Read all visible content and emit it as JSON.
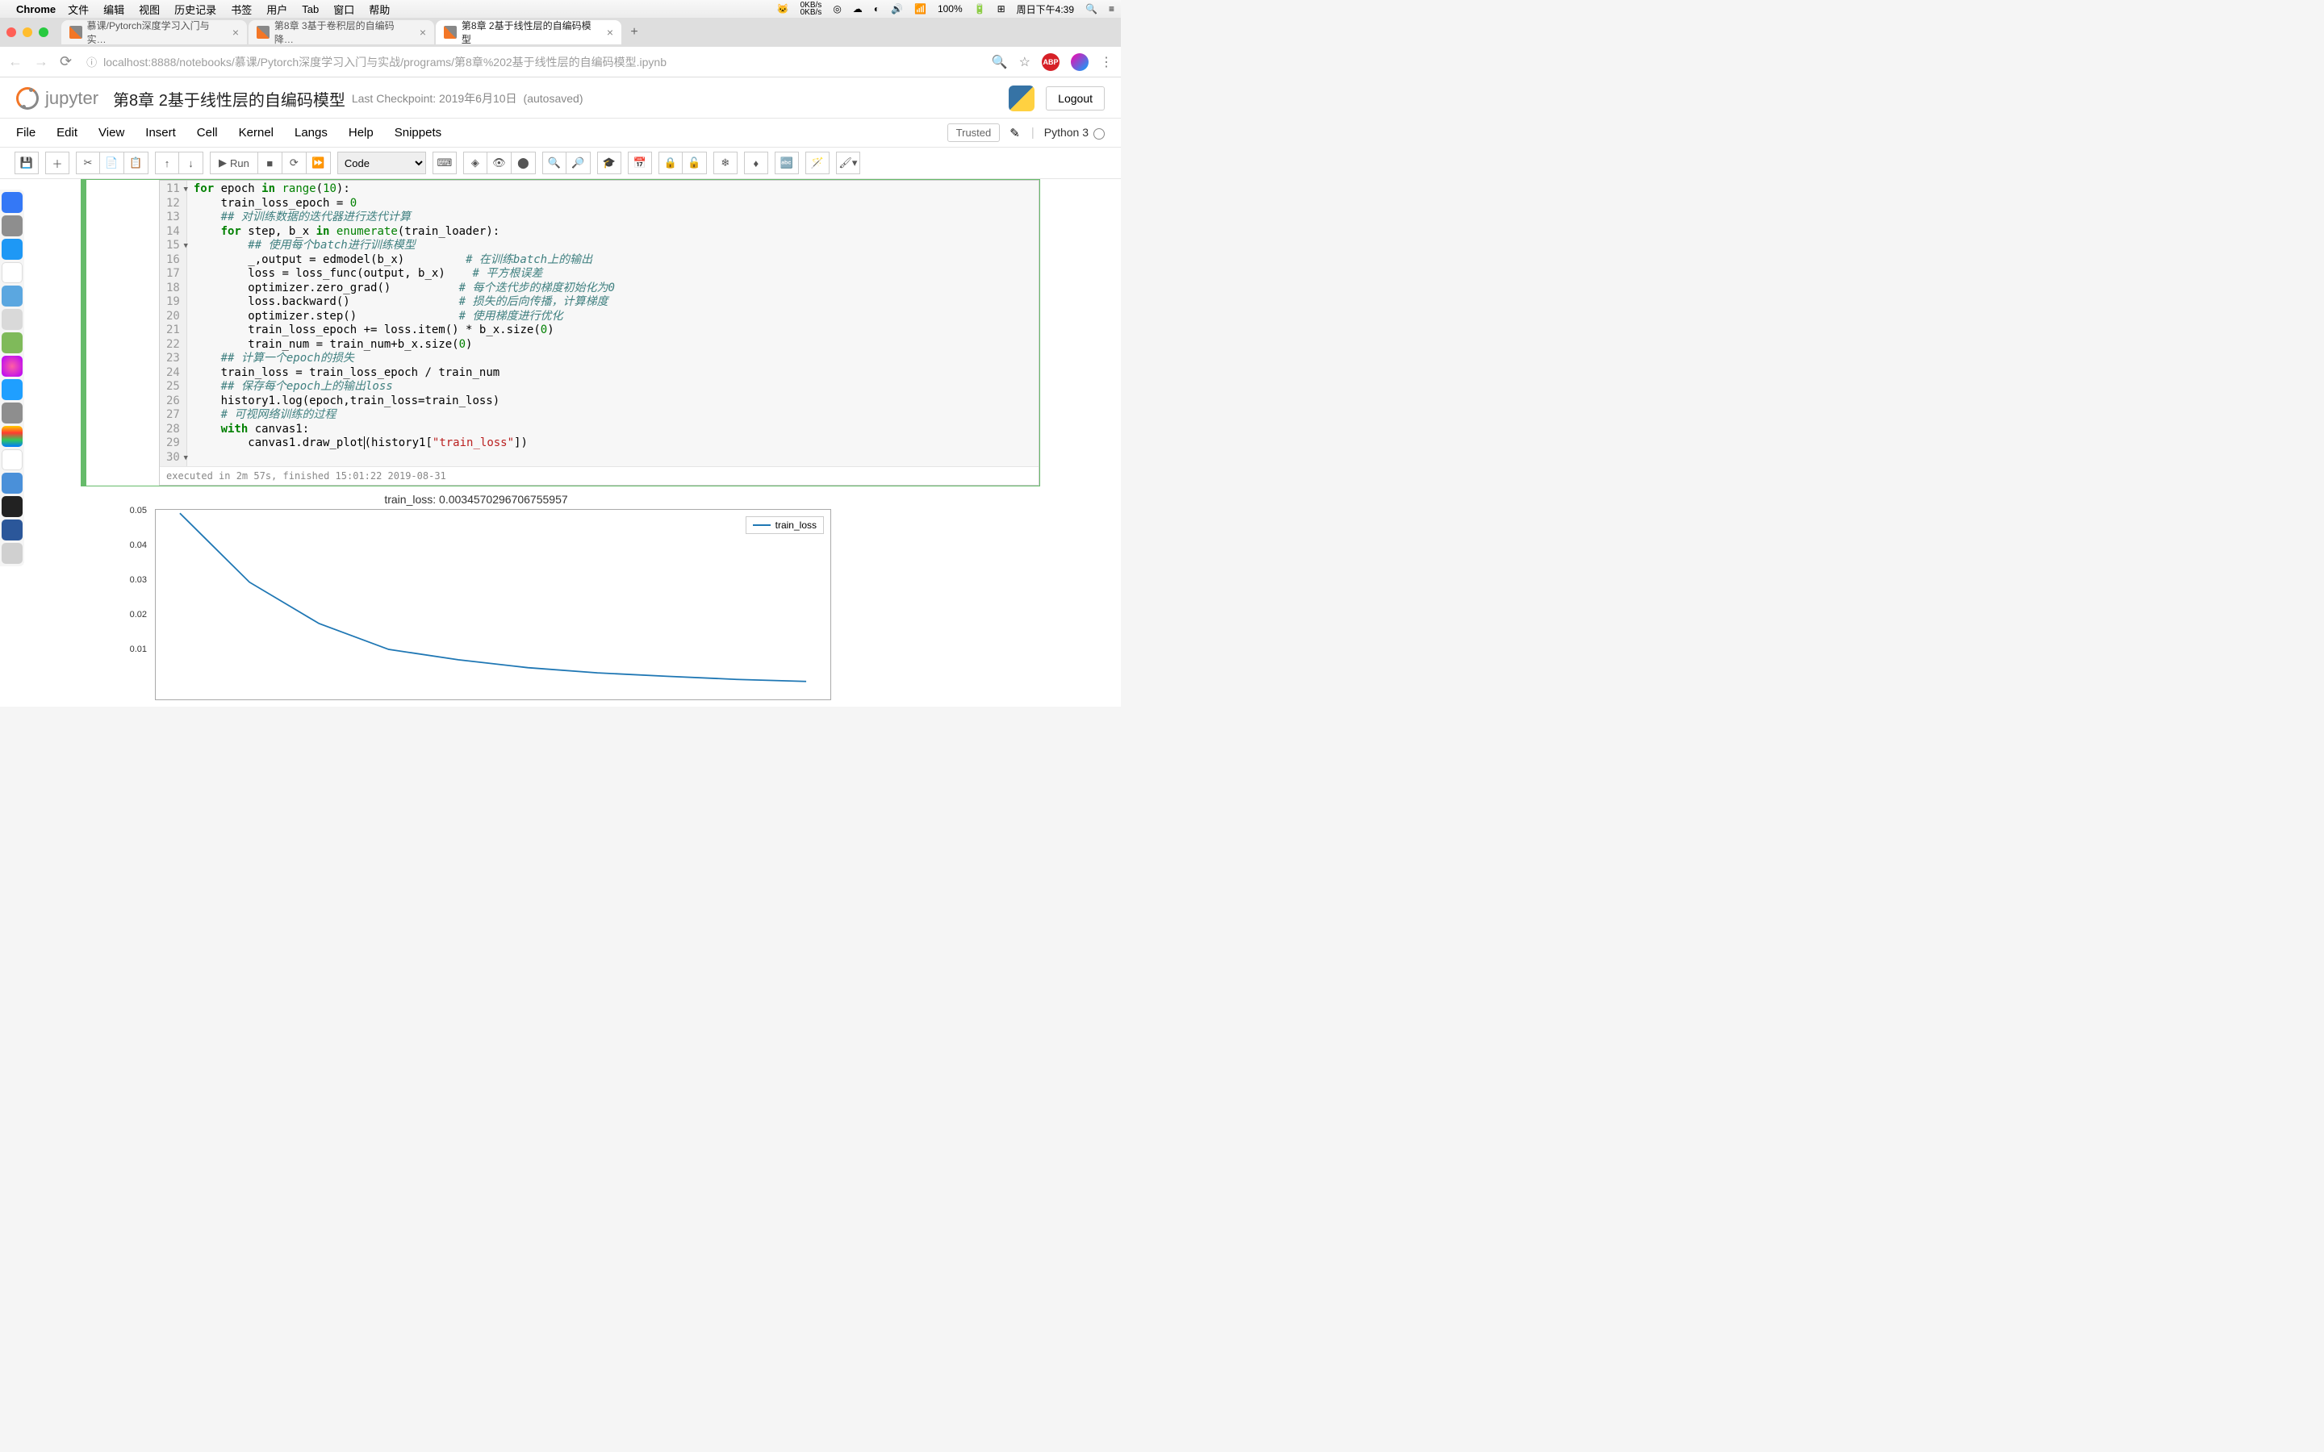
{
  "menubar": {
    "app": "Chrome",
    "items": [
      "文件",
      "编辑",
      "视图",
      "历史记录",
      "书签",
      "用户",
      "Tab",
      "窗口",
      "帮助"
    ],
    "kb_up": "0KB/s",
    "kb_dn": "0KB/s",
    "battery": "100%",
    "clock": "周日下午4:39"
  },
  "tabs": [
    {
      "title": "慕课/Pytorch深度学习入门与实…",
      "active": false
    },
    {
      "title": "第8章 3基于卷积层的自编码降…",
      "active": false
    },
    {
      "title": "第8章 2基于线性层的自编码模型",
      "active": true
    }
  ],
  "url": "localhost:8888/notebooks/慕课/Pytorch深度学习入门与实战/programs/第8章%202基于线性层的自编码模型.ipynb",
  "jupyter": {
    "logo": "jupyter",
    "title": "第8章 2基于线性层的自编码模型",
    "checkpoint": "Last Checkpoint: 2019年6月10日",
    "autosaved": "(autosaved)",
    "logout": "Logout",
    "menus": [
      "File",
      "Edit",
      "View",
      "Insert",
      "Cell",
      "Kernel",
      "Langs",
      "Help",
      "Snippets"
    ],
    "trusted": "Trusted",
    "kernel": "Python 3",
    "run": "Run",
    "celltype": "Code"
  },
  "code": {
    "start_line": 11,
    "lines": [
      {
        "n": 11,
        "fold": true,
        "tokens": [
          [
            "kw",
            "for"
          ],
          [
            "nm",
            " epoch "
          ],
          [
            "kw",
            "in"
          ],
          [
            "nm",
            " "
          ],
          [
            "bi",
            "range"
          ],
          [
            "op",
            "("
          ],
          [
            "num",
            "10"
          ],
          [
            "op",
            "):"
          ]
        ]
      },
      {
        "n": 12,
        "tokens": [
          [
            "nm",
            "    train_loss_epoch "
          ],
          [
            "op",
            "= "
          ],
          [
            "num",
            "0"
          ]
        ]
      },
      {
        "n": 13,
        "tokens": [
          [
            "nm",
            "    "
          ],
          [
            "cm",
            "## 对训练数据的迭代器进行迭代计算"
          ]
        ]
      },
      {
        "n": 14,
        "fold": true,
        "tokens": [
          [
            "nm",
            "    "
          ],
          [
            "kw",
            "for"
          ],
          [
            "nm",
            " step, b_x "
          ],
          [
            "kw",
            "in"
          ],
          [
            "nm",
            " "
          ],
          [
            "bi",
            "enumerate"
          ],
          [
            "op",
            "("
          ],
          [
            "nm",
            "train_loader"
          ],
          [
            "op",
            "):"
          ]
        ]
      },
      {
        "n": 15,
        "tokens": [
          [
            "nm",
            "        "
          ],
          [
            "cm",
            "## 使用每个batch进行训练模型"
          ]
        ]
      },
      {
        "n": 16,
        "tokens": [
          [
            "nm",
            "        _,output "
          ],
          [
            "op",
            "= "
          ],
          [
            "nm",
            "edmodel"
          ],
          [
            "op",
            "("
          ],
          [
            "nm",
            "b_x"
          ],
          [
            "op",
            ")         "
          ],
          [
            "cm",
            "# 在训练batch上的输出"
          ]
        ]
      },
      {
        "n": 17,
        "tokens": [
          [
            "nm",
            "        loss "
          ],
          [
            "op",
            "= "
          ],
          [
            "nm",
            "loss_func"
          ],
          [
            "op",
            "("
          ],
          [
            "nm",
            "output, b_x"
          ],
          [
            "op",
            ")    "
          ],
          [
            "cm",
            "# 平方根误差"
          ]
        ]
      },
      {
        "n": 18,
        "tokens": [
          [
            "nm",
            "        optimizer.zero_grad"
          ],
          [
            "op",
            "()          "
          ],
          [
            "cm",
            "# 每个迭代步的梯度初始化为0"
          ]
        ]
      },
      {
        "n": 19,
        "tokens": [
          [
            "nm",
            "        loss.backward"
          ],
          [
            "op",
            "()                "
          ],
          [
            "cm",
            "# 损失的后向传播，计算梯度"
          ]
        ]
      },
      {
        "n": 20,
        "tokens": [
          [
            "nm",
            "        optimizer.step"
          ],
          [
            "op",
            "()               "
          ],
          [
            "cm",
            "# 使用梯度进行优化"
          ]
        ]
      },
      {
        "n": 21,
        "tokens": [
          [
            "nm",
            "        train_loss_epoch "
          ],
          [
            "op",
            "+= "
          ],
          [
            "nm",
            "loss.item"
          ],
          [
            "op",
            "() * "
          ],
          [
            "nm",
            "b_x.size"
          ],
          [
            "op",
            "("
          ],
          [
            "num",
            "0"
          ],
          [
            "op",
            ")"
          ]
        ]
      },
      {
        "n": 22,
        "tokens": [
          [
            "nm",
            "        train_num "
          ],
          [
            "op",
            "= "
          ],
          [
            "nm",
            "train_num"
          ],
          [
            "op",
            "+"
          ],
          [
            "nm",
            "b_x.size"
          ],
          [
            "op",
            "("
          ],
          [
            "num",
            "0"
          ],
          [
            "op",
            ")"
          ]
        ]
      },
      {
        "n": 23,
        "tokens": [
          [
            "nm",
            "    "
          ],
          [
            "cm",
            "## 计算一个epoch的损失"
          ]
        ]
      },
      {
        "n": 24,
        "tokens": [
          [
            "nm",
            "    train_loss "
          ],
          [
            "op",
            "= "
          ],
          [
            "nm",
            "train_loss_epoch "
          ],
          [
            "op",
            "/ "
          ],
          [
            "nm",
            "train_num"
          ]
        ]
      },
      {
        "n": 25,
        "tokens": [
          [
            "nm",
            "    "
          ],
          [
            "cm",
            "## 保存每个epoch上的输出loss"
          ]
        ]
      },
      {
        "n": 26,
        "tokens": [
          [
            "nm",
            "    history1.log"
          ],
          [
            "op",
            "("
          ],
          [
            "nm",
            "epoch,train_loss"
          ],
          [
            "op",
            "="
          ],
          [
            "nm",
            "train_loss"
          ],
          [
            "op",
            ")"
          ]
        ]
      },
      {
        "n": 27,
        "tokens": [
          [
            "nm",
            "    "
          ],
          [
            "cm",
            "# 可视网络训练的过程"
          ]
        ]
      },
      {
        "n": 28,
        "fold": true,
        "tokens": [
          [
            "nm",
            "    "
          ],
          [
            "kw",
            "with"
          ],
          [
            "nm",
            " canvas1"
          ],
          [
            "op",
            ":"
          ]
        ]
      },
      {
        "n": 29,
        "tokens": [
          [
            "nm",
            "        canvas1.draw_plot"
          ],
          [
            "cursor",
            ""
          ],
          [
            "op",
            "("
          ],
          [
            "nm",
            "history1"
          ],
          [
            "op",
            "["
          ],
          [
            "str",
            "\"train_loss\""
          ],
          [
            "op",
            "])"
          ]
        ]
      },
      {
        "n": 30,
        "tokens": []
      }
    ],
    "executed": "executed in 2m 57s, finished 15:01:22 2019-08-31"
  },
  "chart_data": {
    "type": "line",
    "title": "train_loss: 0.0034570296706755957",
    "legend": "train_loss",
    "ylim": [
      0,
      0.055
    ],
    "yticks": [
      0.01,
      0.02,
      0.03,
      0.04,
      0.05
    ],
    "xticks": [
      0,
      2,
      4,
      6,
      8
    ],
    "x": [
      0,
      1,
      2,
      3,
      4,
      5,
      6,
      7,
      8,
      9
    ],
    "values": [
      0.054,
      0.034,
      0.022,
      0.0145,
      0.0115,
      0.0092,
      0.0077,
      0.0067,
      0.0058,
      0.0052
    ]
  }
}
